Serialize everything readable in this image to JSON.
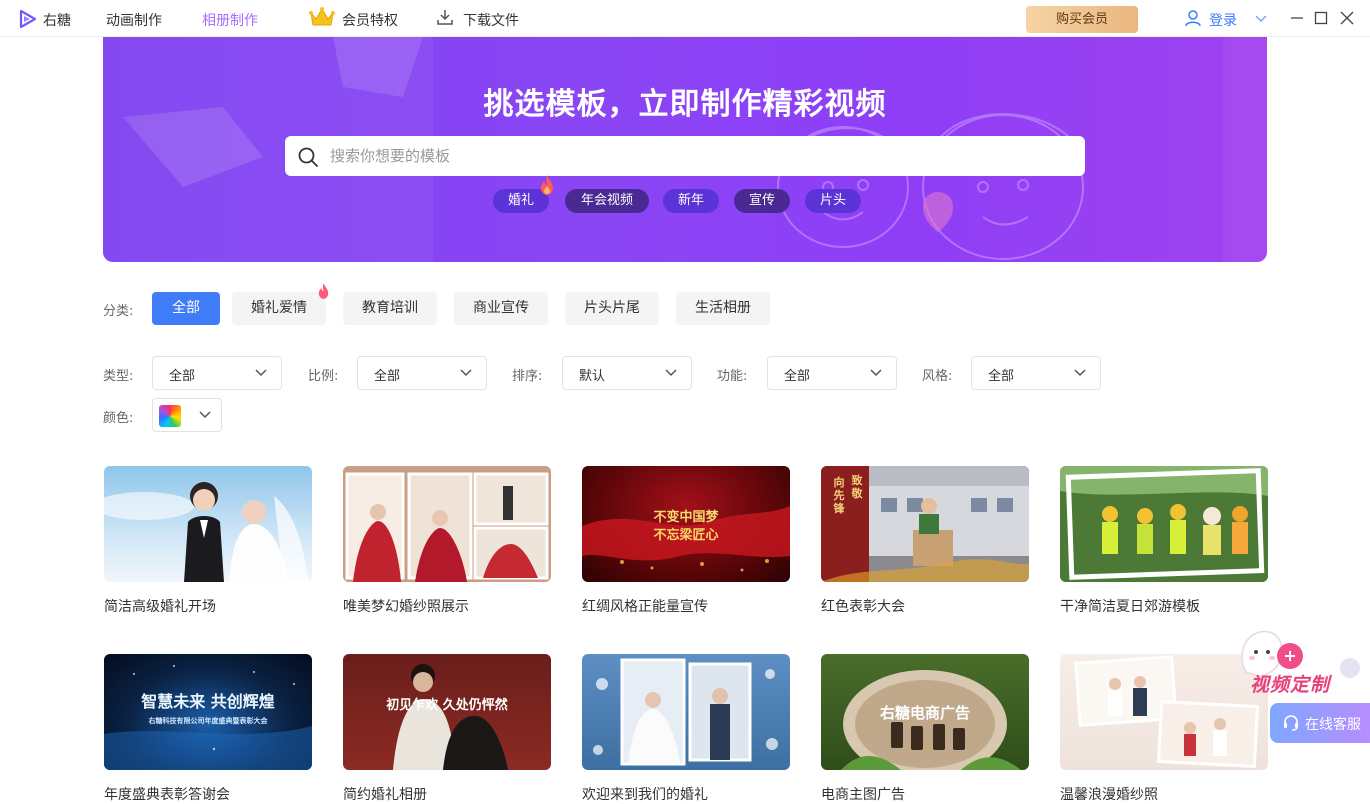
{
  "titlebar": {
    "app_name": "右糖",
    "nav": [
      "动画制作",
      "相册制作",
      "会员特权",
      "下载文件"
    ],
    "buy_label": "购买会员",
    "login_label": "登录"
  },
  "banner": {
    "headline": "挑选模板，立即制作精彩视频",
    "search_placeholder": "搜索你想要的模板",
    "hot_tags": [
      "婚礼",
      "年会视频",
      "新年",
      "宣传",
      "片头"
    ]
  },
  "filters": {
    "category_label": "分类:",
    "categories": [
      "全部",
      "婚礼爱情",
      "教育培训",
      "商业宣传",
      "片头片尾",
      "生活相册"
    ],
    "type_label": "类型:",
    "type_value": "全部",
    "ratio_label": "比例:",
    "ratio_value": "全部",
    "sort_label": "排序:",
    "sort_value": "默认",
    "function_label": "功能:",
    "function_value": "全部",
    "style_label": "风格:",
    "style_value": "全部",
    "color_label": "颜色:"
  },
  "templates": [
    {
      "title": "简洁高级婚礼开场"
    },
    {
      "title": "唯美梦幻婚纱照展示"
    },
    {
      "title": "红绸风格正能量宣传",
      "thumb_text": [
        "不变中国梦",
        "不忘梁匠心"
      ]
    },
    {
      "title": "红色表彰大会",
      "thumb_text": [
        "向先锋",
        "致敬"
      ]
    },
    {
      "title": "干净简洁夏日郊游模板"
    },
    {
      "title": "年度盛典表彰答谢会",
      "thumb_text": [
        "智慧未来 共创辉煌",
        "右糖科技有限公司年度盛典暨表彰大会"
      ]
    },
    {
      "title": "简约婚礼相册",
      "thumb_text": [
        "初见乍欢 久处仍怦然"
      ]
    },
    {
      "title": "欢迎来到我们的婚礼"
    },
    {
      "title": "电商主图广告",
      "thumb_text": [
        "右糖电商广告"
      ]
    },
    {
      "title": "温馨浪漫婚纱照"
    }
  ],
  "floating": {
    "custom_label": "视频定制",
    "service_label": "在线客服"
  },
  "colors": {
    "accent": "#3f7cf7",
    "banner_purple": "#8a46f5",
    "active_nav": "#a66dff"
  }
}
